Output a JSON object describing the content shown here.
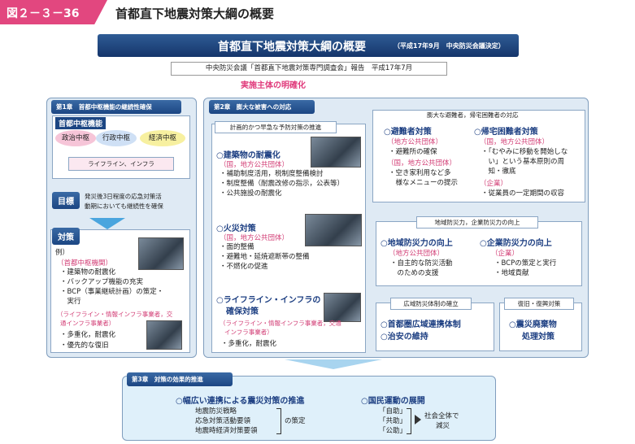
{
  "figure": {
    "number": "図２－３－36",
    "title": "首都直下地震対策大綱の概要"
  },
  "banner": {
    "title": "首都直下地震対策大綱の概要",
    "note": "（平成17年9月　中央防災会議決定）"
  },
  "report": "中央防災会議「首都直下地震対策専門調査会」報告　平成17年7月",
  "subtitle": "実施主体の明確化",
  "chapter1": {
    "head": "第1章　首都中枢機能の継続性確保",
    "central_label": "首都中枢機能",
    "ovals": [
      "政治中枢",
      "行政中枢",
      "経済中枢"
    ],
    "infra": "ライフライン、インフラ",
    "goal_tag": "目標",
    "goal_text": [
      "発災後3日程度の応急対策活",
      "動期においても継続性を確保"
    ],
    "measures_tag": "対策",
    "ex_label": "例）",
    "ex_org": "（首都中枢機関）",
    "items1": [
      "・建築物の耐震化",
      "・バックアップ機能の充実",
      "・BCP（事業継続計画）の策定・",
      "　実行"
    ],
    "ex_org2": "（ライフライン・情報インフラ事業者，交",
    "ex_org2b": "通インフラ事業者）",
    "items2": [
      "・多重化，耐震化",
      "・優先的な復旧"
    ]
  },
  "chapter2": {
    "head": "第2章　膨大な被害への対応",
    "planned_head": "計画的かつ早急な予防対策の推進",
    "b1_title": "○建築物の耐震化",
    "b1_org": "（国，地方公共団体）",
    "b1_items": [
      "・補助制度活用，税制度整備検討",
      "・制度整備（耐震改修の指示，公表等）",
      "・公共施設の耐震化"
    ],
    "b2_title": "○火災対策",
    "b2_org": "（国，地方公共団体）",
    "b2_items": [
      "・面的整備",
      "・避難地・延焼遮断帯の整備",
      "・不燃化の促進"
    ],
    "b3_title1": "○ライフライン・インフラの",
    "b3_title2": "確保対策",
    "b3_org1": "（ライフライン・情報インフラ事業者，交通",
    "b3_org2": "インフラ事業者）",
    "b3_items": [
      "・多重化，耐震化"
    ],
    "evac_head": "膨大な避難者，帰宅困難者の対応",
    "evac_title": "○避難者対策",
    "evac_org": "（地方公共団体）",
    "evac_items": [
      "・避難所の確保",
      "（国，地方公共団体）",
      "・空き家利用など多",
      "　様なメニューの提示"
    ],
    "ret_title": "○帰宅困難者対策",
    "ret_org": "（国，地方公共団体）",
    "ret_items": [
      "・「むやみに移動を開始しな",
      "　い」という基本原則の周",
      "　知・徹底"
    ],
    "ret_org2": "（企業）",
    "ret_items2": [
      "・従業員の一定期間の収容"
    ],
    "local_head": "地域防災力，企業防災力の向上",
    "local_title": "○地域防災力の向上",
    "local_org": "（地方公共団体）",
    "local_items": [
      "・自主的な防災活動",
      "　のための支援"
    ],
    "corp_title": "○企業防災力の向上",
    "corp_org": "（企業）",
    "corp_items": [
      "・BCPの策定と実行",
      "・地域貢献"
    ],
    "wide_head": "広域防災体制の確立",
    "wide_items": [
      "○首都圏広域連携体制",
      "○治安の維持"
    ],
    "recov_head": "復旧・復興対策",
    "recov_items": [
      "○震災廃棄物",
      "処理対策"
    ]
  },
  "chapter3": {
    "head": "第3章　対策の効果的推進",
    "left_title": "○幅広い連携による震災対策の推進",
    "left_items": [
      "地震防災戦略",
      "応急対策活動要領",
      "地震時経済対策要領"
    ],
    "left_suffix": "の策定",
    "right_title": "○国民運動の展開",
    "right_items": [
      "「自助」",
      "「共助」",
      "「公助」"
    ],
    "right_result1": "社会全体で",
    "right_result2": "減災"
  }
}
